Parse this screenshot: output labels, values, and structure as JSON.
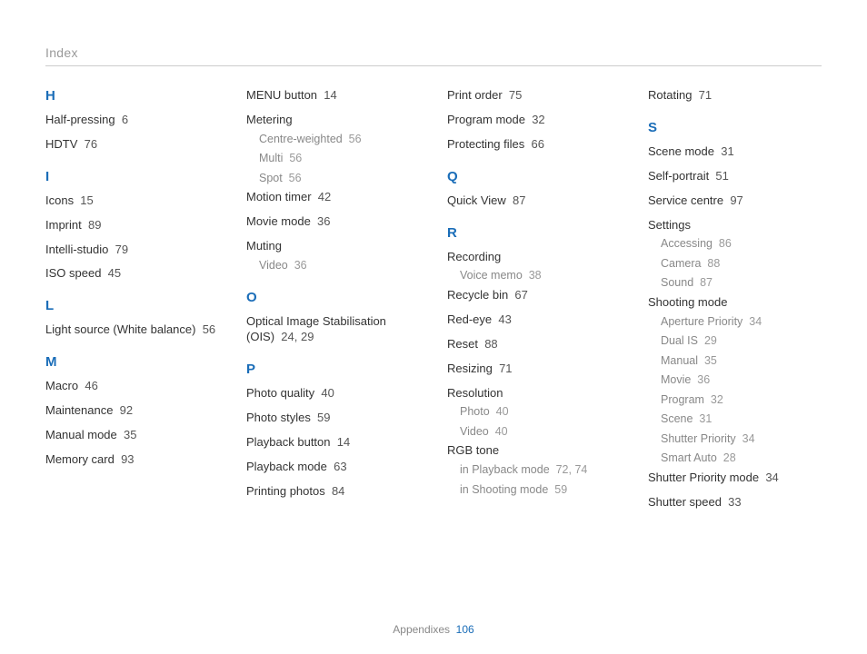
{
  "header": "Index",
  "footer": {
    "label": "Appendixes",
    "page": "106"
  },
  "columns": [
    [
      {
        "type": "letter",
        "text": "H"
      },
      {
        "type": "entry",
        "text": "Half-pressing",
        "page": "6"
      },
      {
        "type": "entry",
        "text": "HDTV",
        "page": "76"
      },
      {
        "type": "letter",
        "text": "I"
      },
      {
        "type": "entry",
        "text": "Icons",
        "page": "15"
      },
      {
        "type": "entry",
        "text": "Imprint",
        "page": "89"
      },
      {
        "type": "entry",
        "text": "Intelli-studio",
        "page": "79"
      },
      {
        "type": "entry",
        "text": "ISO speed",
        "page": "45"
      },
      {
        "type": "letter",
        "text": "L"
      },
      {
        "type": "entry",
        "text": "Light source (White balance)",
        "page": "56"
      },
      {
        "type": "letter",
        "text": "M"
      },
      {
        "type": "entry",
        "text": "Macro",
        "page": "46"
      },
      {
        "type": "entry",
        "text": "Maintenance",
        "page": "92"
      },
      {
        "type": "entry",
        "text": "Manual mode",
        "page": "35"
      },
      {
        "type": "entry",
        "text": "Memory card",
        "page": "93"
      }
    ],
    [
      {
        "type": "entry",
        "text": "MENU button",
        "page": "14"
      },
      {
        "type": "subheading",
        "text": "Metering"
      },
      {
        "type": "sub",
        "text": "Centre-weighted",
        "page": "56"
      },
      {
        "type": "sub",
        "text": "Multi",
        "page": "56"
      },
      {
        "type": "sub",
        "text": "Spot",
        "page": "56"
      },
      {
        "type": "entry",
        "text": "Motion timer",
        "page": "42"
      },
      {
        "type": "entry",
        "text": "Movie mode",
        "page": "36"
      },
      {
        "type": "subheading",
        "text": "Muting"
      },
      {
        "type": "sub",
        "text": "Video",
        "page": "36"
      },
      {
        "type": "letter",
        "text": "O"
      },
      {
        "type": "entry",
        "text": "Optical Image Stabilisation (OIS)",
        "page": "24, 29"
      },
      {
        "type": "letter",
        "text": "P"
      },
      {
        "type": "entry",
        "text": "Photo quality",
        "page": "40"
      },
      {
        "type": "entry",
        "text": "Photo styles",
        "page": "59"
      },
      {
        "type": "entry",
        "text": "Playback button",
        "page": "14"
      },
      {
        "type": "entry",
        "text": "Playback mode",
        "page": "63"
      },
      {
        "type": "entry",
        "text": "Printing photos",
        "page": "84"
      }
    ],
    [
      {
        "type": "entry",
        "text": "Print order",
        "page": "75"
      },
      {
        "type": "entry",
        "text": "Program mode",
        "page": "32"
      },
      {
        "type": "entry",
        "text": "Protecting files",
        "page": "66"
      },
      {
        "type": "letter",
        "text": "Q"
      },
      {
        "type": "entry",
        "text": "Quick View",
        "page": "87"
      },
      {
        "type": "letter",
        "text": "R"
      },
      {
        "type": "subheading",
        "text": "Recording"
      },
      {
        "type": "sub",
        "text": "Voice memo",
        "page": "38"
      },
      {
        "type": "entry",
        "text": "Recycle bin",
        "page": "67"
      },
      {
        "type": "entry",
        "text": "Red-eye",
        "page": "43"
      },
      {
        "type": "entry",
        "text": "Reset",
        "page": "88"
      },
      {
        "type": "entry",
        "text": "Resizing",
        "page": "71"
      },
      {
        "type": "subheading",
        "text": "Resolution"
      },
      {
        "type": "sub",
        "text": "Photo",
        "page": "40"
      },
      {
        "type": "sub",
        "text": "Video",
        "page": "40"
      },
      {
        "type": "subheading",
        "text": "RGB tone"
      },
      {
        "type": "sub",
        "text": "in Playback mode",
        "page": "72, 74"
      },
      {
        "type": "sub",
        "text": "in Shooting mode",
        "page": "59"
      }
    ],
    [
      {
        "type": "entry",
        "text": "Rotating",
        "page": "71"
      },
      {
        "type": "letter",
        "text": "S"
      },
      {
        "type": "entry",
        "text": "Scene mode",
        "page": "31"
      },
      {
        "type": "entry",
        "text": "Self-portrait",
        "page": "51"
      },
      {
        "type": "entry",
        "text": "Service centre",
        "page": "97"
      },
      {
        "type": "subheading",
        "text": "Settings"
      },
      {
        "type": "sub",
        "text": "Accessing",
        "page": "86"
      },
      {
        "type": "sub",
        "text": "Camera",
        "page": "88"
      },
      {
        "type": "sub",
        "text": "Sound",
        "page": "87"
      },
      {
        "type": "subheading",
        "text": "Shooting mode"
      },
      {
        "type": "sub",
        "text": "Aperture Priority",
        "page": "34"
      },
      {
        "type": "sub",
        "text": "Dual IS",
        "page": "29"
      },
      {
        "type": "sub",
        "text": "Manual",
        "page": "35"
      },
      {
        "type": "sub",
        "text": "Movie",
        "page": "36"
      },
      {
        "type": "sub",
        "text": "Program",
        "page": "32"
      },
      {
        "type": "sub",
        "text": "Scene",
        "page": "31"
      },
      {
        "type": "sub",
        "text": "Shutter Priority",
        "page": "34"
      },
      {
        "type": "sub",
        "text": "Smart Auto",
        "page": "28"
      },
      {
        "type": "entry",
        "text": "Shutter Priority mode",
        "page": "34"
      },
      {
        "type": "entry",
        "text": "Shutter speed",
        "page": "33"
      }
    ]
  ]
}
